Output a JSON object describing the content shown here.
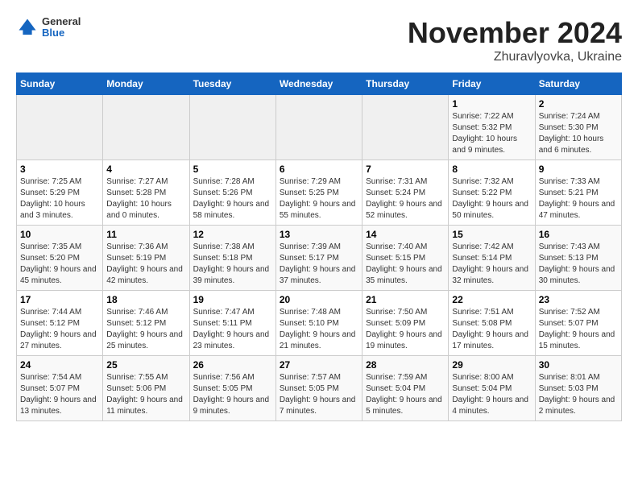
{
  "header": {
    "logo": {
      "line1": "General",
      "line2": "Blue"
    },
    "month": "November 2024",
    "location": "Zhuravlyovka, Ukraine"
  },
  "weekdays": [
    "Sunday",
    "Monday",
    "Tuesday",
    "Wednesday",
    "Thursday",
    "Friday",
    "Saturday"
  ],
  "weeks": [
    [
      {
        "day": "",
        "info": ""
      },
      {
        "day": "",
        "info": ""
      },
      {
        "day": "",
        "info": ""
      },
      {
        "day": "",
        "info": ""
      },
      {
        "day": "",
        "info": ""
      },
      {
        "day": "1",
        "info": "Sunrise: 7:22 AM\nSunset: 5:32 PM\nDaylight: 10 hours and 9 minutes."
      },
      {
        "day": "2",
        "info": "Sunrise: 7:24 AM\nSunset: 5:30 PM\nDaylight: 10 hours and 6 minutes."
      }
    ],
    [
      {
        "day": "3",
        "info": "Sunrise: 7:25 AM\nSunset: 5:29 PM\nDaylight: 10 hours and 3 minutes."
      },
      {
        "day": "4",
        "info": "Sunrise: 7:27 AM\nSunset: 5:28 PM\nDaylight: 10 hours and 0 minutes."
      },
      {
        "day": "5",
        "info": "Sunrise: 7:28 AM\nSunset: 5:26 PM\nDaylight: 9 hours and 58 minutes."
      },
      {
        "day": "6",
        "info": "Sunrise: 7:29 AM\nSunset: 5:25 PM\nDaylight: 9 hours and 55 minutes."
      },
      {
        "day": "7",
        "info": "Sunrise: 7:31 AM\nSunset: 5:24 PM\nDaylight: 9 hours and 52 minutes."
      },
      {
        "day": "8",
        "info": "Sunrise: 7:32 AM\nSunset: 5:22 PM\nDaylight: 9 hours and 50 minutes."
      },
      {
        "day": "9",
        "info": "Sunrise: 7:33 AM\nSunset: 5:21 PM\nDaylight: 9 hours and 47 minutes."
      }
    ],
    [
      {
        "day": "10",
        "info": "Sunrise: 7:35 AM\nSunset: 5:20 PM\nDaylight: 9 hours and 45 minutes."
      },
      {
        "day": "11",
        "info": "Sunrise: 7:36 AM\nSunset: 5:19 PM\nDaylight: 9 hours and 42 minutes."
      },
      {
        "day": "12",
        "info": "Sunrise: 7:38 AM\nSunset: 5:18 PM\nDaylight: 9 hours and 39 minutes."
      },
      {
        "day": "13",
        "info": "Sunrise: 7:39 AM\nSunset: 5:17 PM\nDaylight: 9 hours and 37 minutes."
      },
      {
        "day": "14",
        "info": "Sunrise: 7:40 AM\nSunset: 5:15 PM\nDaylight: 9 hours and 35 minutes."
      },
      {
        "day": "15",
        "info": "Sunrise: 7:42 AM\nSunset: 5:14 PM\nDaylight: 9 hours and 32 minutes."
      },
      {
        "day": "16",
        "info": "Sunrise: 7:43 AM\nSunset: 5:13 PM\nDaylight: 9 hours and 30 minutes."
      }
    ],
    [
      {
        "day": "17",
        "info": "Sunrise: 7:44 AM\nSunset: 5:12 PM\nDaylight: 9 hours and 27 minutes."
      },
      {
        "day": "18",
        "info": "Sunrise: 7:46 AM\nSunset: 5:12 PM\nDaylight: 9 hours and 25 minutes."
      },
      {
        "day": "19",
        "info": "Sunrise: 7:47 AM\nSunset: 5:11 PM\nDaylight: 9 hours and 23 minutes."
      },
      {
        "day": "20",
        "info": "Sunrise: 7:48 AM\nSunset: 5:10 PM\nDaylight: 9 hours and 21 minutes."
      },
      {
        "day": "21",
        "info": "Sunrise: 7:50 AM\nSunset: 5:09 PM\nDaylight: 9 hours and 19 minutes."
      },
      {
        "day": "22",
        "info": "Sunrise: 7:51 AM\nSunset: 5:08 PM\nDaylight: 9 hours and 17 minutes."
      },
      {
        "day": "23",
        "info": "Sunrise: 7:52 AM\nSunset: 5:07 PM\nDaylight: 9 hours and 15 minutes."
      }
    ],
    [
      {
        "day": "24",
        "info": "Sunrise: 7:54 AM\nSunset: 5:07 PM\nDaylight: 9 hours and 13 minutes."
      },
      {
        "day": "25",
        "info": "Sunrise: 7:55 AM\nSunset: 5:06 PM\nDaylight: 9 hours and 11 minutes."
      },
      {
        "day": "26",
        "info": "Sunrise: 7:56 AM\nSunset: 5:05 PM\nDaylight: 9 hours and 9 minutes."
      },
      {
        "day": "27",
        "info": "Sunrise: 7:57 AM\nSunset: 5:05 PM\nDaylight: 9 hours and 7 minutes."
      },
      {
        "day": "28",
        "info": "Sunrise: 7:59 AM\nSunset: 5:04 PM\nDaylight: 9 hours and 5 minutes."
      },
      {
        "day": "29",
        "info": "Sunrise: 8:00 AM\nSunset: 5:04 PM\nDaylight: 9 hours and 4 minutes."
      },
      {
        "day": "30",
        "info": "Sunrise: 8:01 AM\nSunset: 5:03 PM\nDaylight: 9 hours and 2 minutes."
      }
    ]
  ]
}
